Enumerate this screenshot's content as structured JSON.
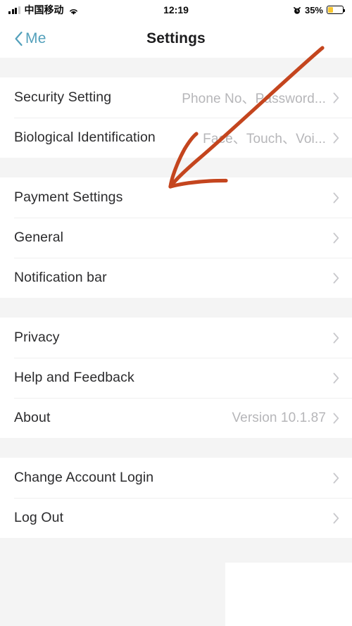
{
  "status_bar": {
    "carrier": "中国移动",
    "time": "12:19",
    "battery_percent": "35%",
    "battery_level": 35,
    "signal_icon": "signal-bars-icon",
    "wifi_icon": "wifi-icon",
    "alarm_icon": "alarm-clock-icon",
    "battery_icon": "battery-icon",
    "battery_color": "#f9c631"
  },
  "nav": {
    "back_label": "Me",
    "back_icon": "chevron-left-icon",
    "title": "Settings",
    "accent_color": "#53a0bb"
  },
  "groups": [
    {
      "rows": [
        {
          "label": "Security Setting",
          "value": "Phone No、Password...",
          "chevron": "chevron-right-icon"
        },
        {
          "label": "Biological Identification",
          "value": "Face、Touch、Voi...",
          "chevron": "chevron-right-icon"
        }
      ]
    },
    {
      "rows": [
        {
          "label": "Payment Settings",
          "value": "",
          "chevron": "chevron-right-icon"
        },
        {
          "label": "General",
          "value": "",
          "chevron": "chevron-right-icon"
        },
        {
          "label": "Notification bar",
          "value": "",
          "chevron": "chevron-right-icon"
        }
      ]
    },
    {
      "rows": [
        {
          "label": "Privacy",
          "value": "",
          "chevron": "chevron-right-icon"
        },
        {
          "label": "Help and Feedback",
          "value": "",
          "chevron": "chevron-right-icon"
        },
        {
          "label": "About",
          "value": "Version 10.1.87",
          "chevron": "chevron-right-icon"
        }
      ]
    },
    {
      "rows": [
        {
          "label": "Change Account Login",
          "value": "",
          "chevron": "chevron-right-icon"
        },
        {
          "label": "Log Out",
          "value": "",
          "chevron": "chevron-right-icon"
        }
      ]
    }
  ],
  "annotation": {
    "type": "hand-drawn-arrow",
    "color": "#c4451e",
    "points_at": "Payment Settings"
  }
}
